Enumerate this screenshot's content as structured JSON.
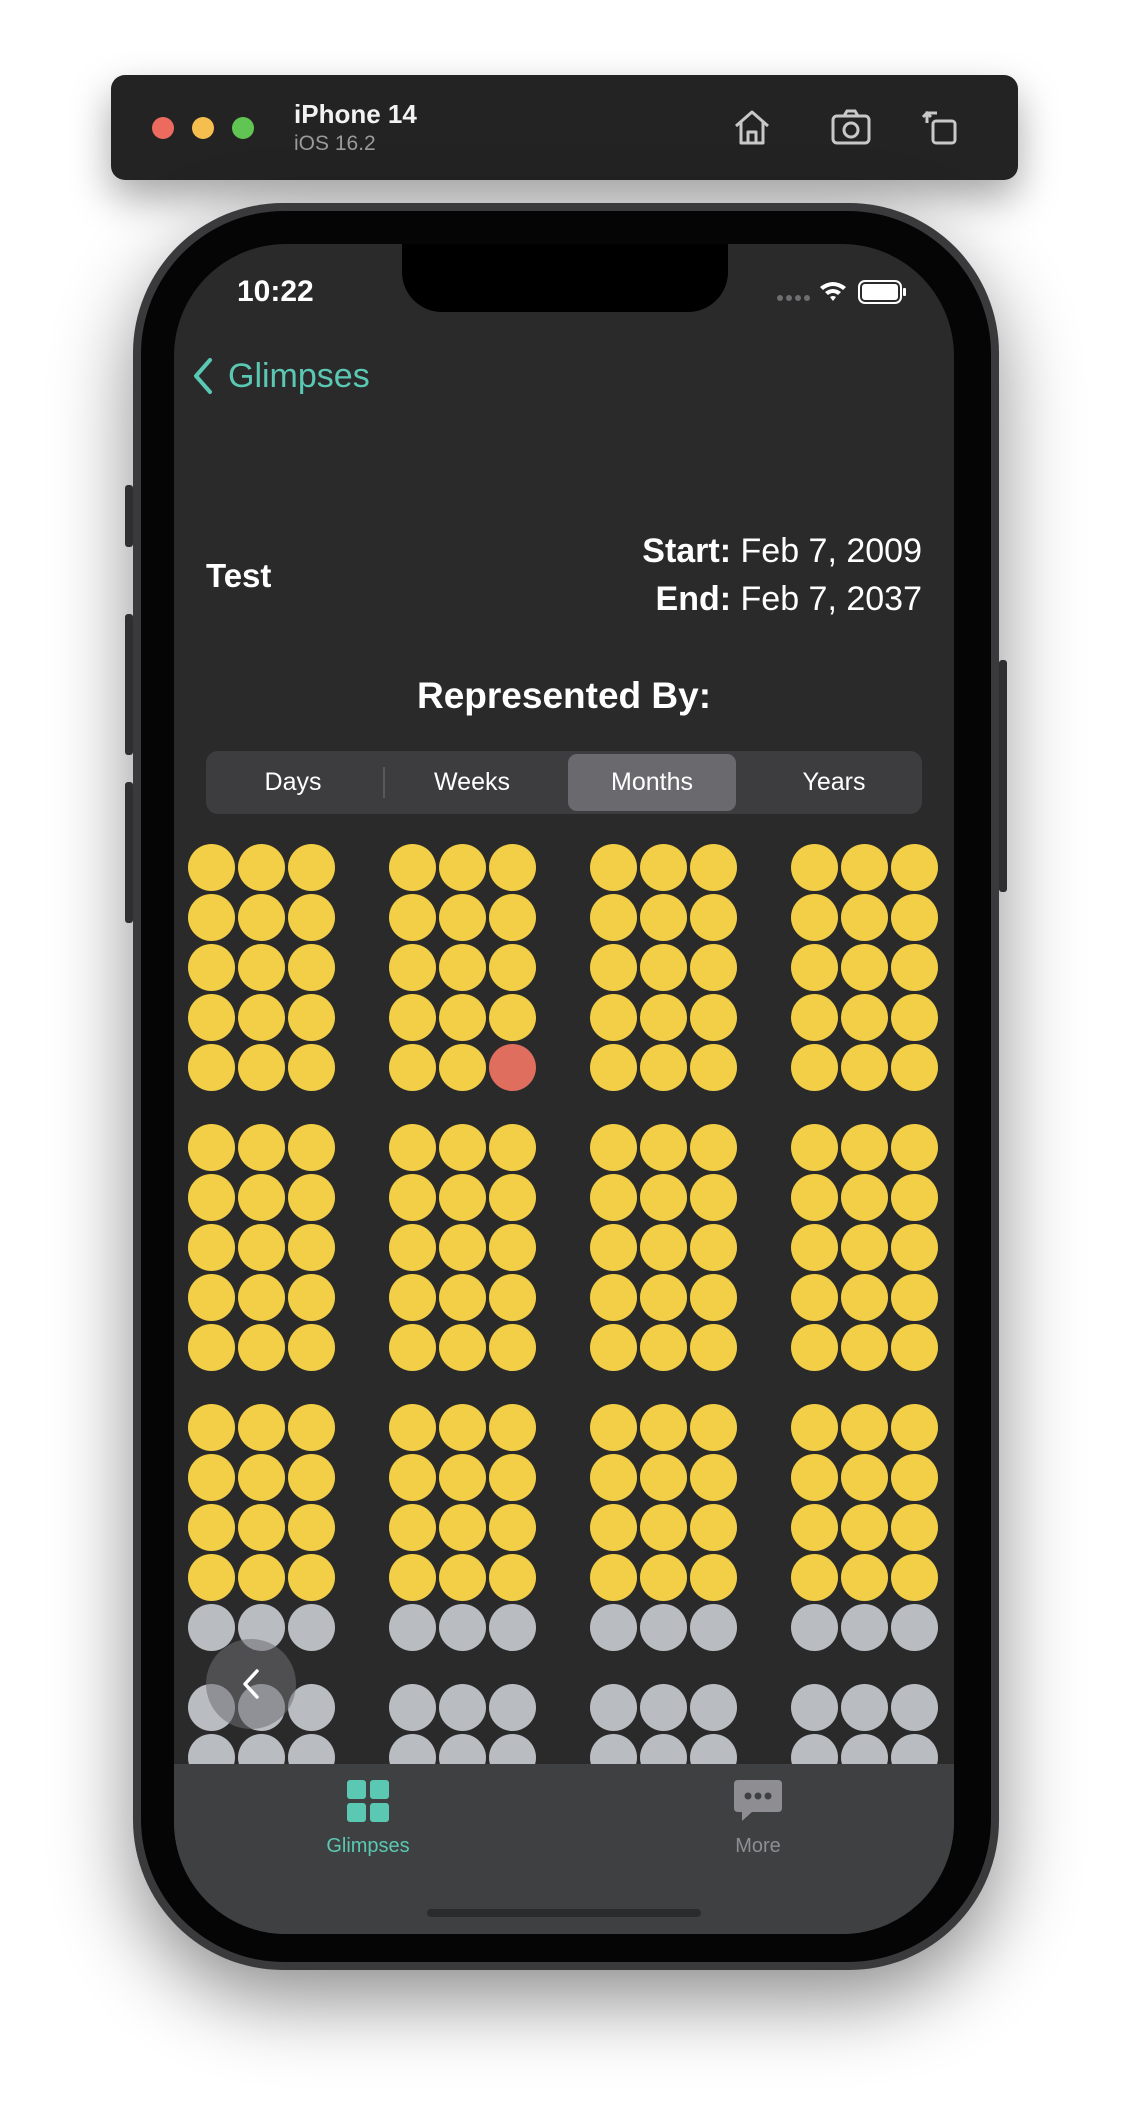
{
  "simulator": {
    "device": "iPhone 14",
    "os": "iOS 16.2",
    "icons": [
      "home-icon",
      "screenshot-icon",
      "rotate-icon"
    ]
  },
  "status_bar": {
    "time": "10:22"
  },
  "nav": {
    "back_label": "Glimpses"
  },
  "glimpse": {
    "name": "Test",
    "start_label": "Start:",
    "start_date": "Feb 7, 2009",
    "end_label": "End:",
    "end_date": "Feb 7, 2037"
  },
  "represented_by": "Represented By:",
  "segments": [
    {
      "label": "Days",
      "selected": false
    },
    {
      "label": "Weeks",
      "selected": false
    },
    {
      "label": "Months",
      "selected": true
    },
    {
      "label": "Years",
      "selected": false
    }
  ],
  "colors": {
    "elapsed": "#f2cf46",
    "current": "#e06e5f",
    "remaining": "#b9bdc1",
    "accent": "#5ac8b3"
  },
  "year_blocks": [
    [
      "y",
      "y",
      "y",
      "y",
      "y",
      "y",
      "y",
      "y",
      "y",
      "y",
      "y",
      "y",
      "y",
      "y",
      "y"
    ],
    [
      "y",
      "y",
      "y",
      "y",
      "y",
      "y",
      "y",
      "y",
      "y",
      "y",
      "y",
      "y",
      "y",
      "y",
      "r"
    ],
    [
      "y",
      "y",
      "y",
      "y",
      "y",
      "y",
      "y",
      "y",
      "y",
      "y",
      "y",
      "y",
      "y",
      "y",
      "y"
    ],
    [
      "y",
      "y",
      "y",
      "y",
      "y",
      "y",
      "y",
      "y",
      "y",
      "y",
      "y",
      "y",
      "y",
      "y",
      "y"
    ],
    [
      "y",
      "y",
      "y",
      "y",
      "y",
      "y",
      "y",
      "y",
      "y",
      "y",
      "y",
      "y",
      "y",
      "y",
      "y"
    ],
    [
      "y",
      "y",
      "y",
      "y",
      "y",
      "y",
      "y",
      "y",
      "y",
      "y",
      "y",
      "y",
      "y",
      "y",
      "y"
    ],
    [
      "y",
      "y",
      "y",
      "y",
      "y",
      "y",
      "y",
      "y",
      "y",
      "y",
      "y",
      "y",
      "y",
      "y",
      "y"
    ],
    [
      "y",
      "y",
      "y",
      "y",
      "y",
      "y",
      "y",
      "y",
      "y",
      "y",
      "y",
      "y",
      "y",
      "y",
      "y"
    ],
    [
      "y",
      "y",
      "y",
      "y",
      "y",
      "y",
      "y",
      "y",
      "y",
      "y",
      "y",
      "y",
      "g",
      "g",
      "g"
    ],
    [
      "y",
      "y",
      "y",
      "y",
      "y",
      "y",
      "y",
      "y",
      "y",
      "y",
      "y",
      "y",
      "g",
      "g",
      "g"
    ],
    [
      "y",
      "y",
      "y",
      "y",
      "y",
      "y",
      "y",
      "y",
      "y",
      "y",
      "y",
      "y",
      "g",
      "g",
      "g"
    ],
    [
      "y",
      "y",
      "y",
      "y",
      "y",
      "y",
      "y",
      "y",
      "y",
      "y",
      "y",
      "y",
      "g",
      "g",
      "g"
    ],
    [
      "g",
      "g",
      "g",
      "g",
      "g",
      "g"
    ],
    [
      "g",
      "g",
      "g",
      "g",
      "g",
      "g"
    ],
    [
      "g",
      "g",
      "g",
      "g",
      "g",
      "g"
    ],
    [
      "g",
      "g",
      "g",
      "g",
      "g",
      "g"
    ]
  ],
  "tabs": [
    {
      "label": "Glimpses",
      "icon": "grid-icon",
      "active": true
    },
    {
      "label": "More",
      "icon": "chat-bubble-icon",
      "active": false
    }
  ]
}
